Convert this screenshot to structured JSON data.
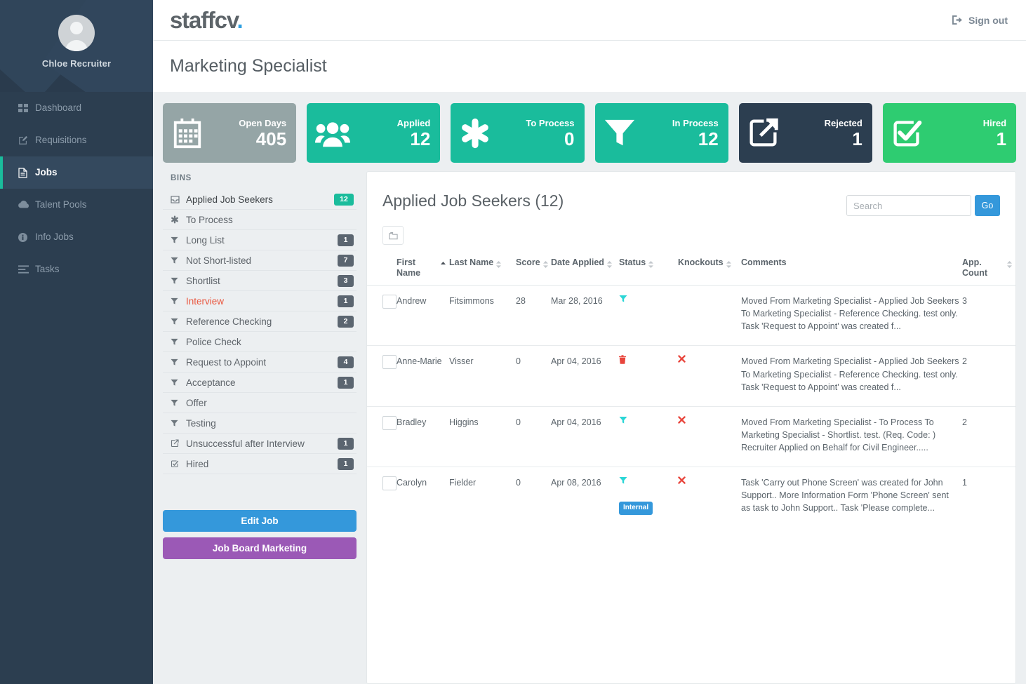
{
  "sidebar": {
    "user_name": "Chloe Recruiter",
    "items": [
      {
        "label": "Dashboard",
        "icon": "grid-icon",
        "active": false
      },
      {
        "label": "Requisitions",
        "icon": "edit-square-icon",
        "active": false
      },
      {
        "label": "Jobs",
        "icon": "document-icon",
        "active": true
      },
      {
        "label": "Talent Pools",
        "icon": "cloud-icon",
        "active": false
      },
      {
        "label": "Info Jobs",
        "icon": "info-circle-icon",
        "active": false
      },
      {
        "label": "Tasks",
        "icon": "list-icon",
        "active": false
      }
    ]
  },
  "topbar": {
    "logo": "staffcv",
    "logo_dot": ".",
    "signout_label": "Sign out"
  },
  "page": {
    "title": "Marketing Specialist"
  },
  "stats": [
    {
      "label": "Open Days",
      "value": "405",
      "icon": "calendar-icon",
      "color": "#95a5a6"
    },
    {
      "label": "Applied",
      "value": "12",
      "icon": "people-icon",
      "color": "#1abc9c"
    },
    {
      "label": "To Process",
      "value": "0",
      "icon": "asterisk-icon",
      "color": "#1abc9c"
    },
    {
      "label": "In Process",
      "value": "12",
      "icon": "funnel-icon",
      "color": "#1abc9c"
    },
    {
      "label": "Rejected",
      "value": "1",
      "icon": "external-link-icon",
      "color": "#2c3e50"
    },
    {
      "label": "Hired",
      "value": "1",
      "icon": "check-square-icon",
      "color": "#2ecc71"
    }
  ],
  "bins": {
    "heading": "BINS",
    "items": [
      {
        "label": "Applied Job Seekers",
        "count": "12",
        "icon": "inbox-icon",
        "style": "teal"
      },
      {
        "label": "To Process",
        "count": "",
        "icon": "asterisk-icon",
        "style": "normal"
      },
      {
        "label": "Long List",
        "count": "1",
        "icon": "funnel-icon",
        "style": "normal"
      },
      {
        "label": "Not Short-listed",
        "count": "7",
        "icon": "funnel-icon",
        "style": "normal"
      },
      {
        "label": "Shortlist",
        "count": "3",
        "icon": "funnel-icon",
        "style": "normal"
      },
      {
        "label": "Interview",
        "count": "1",
        "icon": "funnel-icon",
        "style": "alert"
      },
      {
        "label": "Reference Checking",
        "count": "2",
        "icon": "funnel-icon",
        "style": "normal"
      },
      {
        "label": "Police Check",
        "count": "",
        "icon": "funnel-icon",
        "style": "normal"
      },
      {
        "label": "Request to Appoint",
        "count": "4",
        "icon": "funnel-icon",
        "style": "normal"
      },
      {
        "label": "Acceptance",
        "count": "1",
        "icon": "funnel-icon",
        "style": "normal"
      },
      {
        "label": "Offer",
        "count": "",
        "icon": "funnel-icon",
        "style": "normal"
      },
      {
        "label": "Testing",
        "count": "",
        "icon": "funnel-icon",
        "style": "normal"
      },
      {
        "label": "Unsuccessful after Interview",
        "count": "1",
        "icon": "external-link-icon",
        "style": "normal"
      },
      {
        "label": "Hired",
        "count": "1",
        "icon": "check-square-icon",
        "style": "normal"
      }
    ],
    "edit_job_label": "Edit Job",
    "job_board_label": "Job Board Marketing"
  },
  "panel": {
    "title": "Applied Job Seekers (12)",
    "search_placeholder": "Search",
    "search_value": "",
    "go_label": "Go",
    "columns": [
      {
        "label": "First Name",
        "sort": "asc"
      },
      {
        "label": "Last Name",
        "sort": "both"
      },
      {
        "label": "Score",
        "sort": "both"
      },
      {
        "label": "Date Applied",
        "sort": "both"
      },
      {
        "label": "Status",
        "sort": "both"
      },
      {
        "label": "Knockouts",
        "sort": "both"
      },
      {
        "label": "Comments",
        "sort": "none"
      },
      {
        "label": "App. Count",
        "sort": "both"
      }
    ],
    "rows": [
      {
        "first_name": "Andrew",
        "last_name": "Fitsimmons",
        "score": "28",
        "date_applied": "Mar 28, 2016",
        "status_icon": "funnel-icon",
        "status_badge": "",
        "knockout_icon": "",
        "comments": "Moved From Marketing Specialist - Applied Job Seekers To Marketing Specialist - Reference Checking. test only. Task 'Request to Appoint' was created f...",
        "app_count": "3"
      },
      {
        "first_name": "Anne-Marie",
        "last_name": "Visser",
        "score": "0",
        "date_applied": "Apr 04, 2016",
        "status_icon": "trash-icon",
        "status_badge": "",
        "knockout_icon": "x-icon",
        "comments": "Moved From Marketing Specialist - Applied Job Seekers To Marketing Specialist - Reference Checking. test only. Task 'Request to Appoint' was created f...",
        "app_count": "2"
      },
      {
        "first_name": "Bradley",
        "last_name": "Higgins",
        "score": "0",
        "date_applied": "Apr 04, 2016",
        "status_icon": "funnel-icon",
        "status_badge": "",
        "knockout_icon": "x-icon",
        "comments": "Moved From Marketing Specialist - To Process To Marketing Specialist - Shortlist. test. (Req. Code: ) Recruiter Applied on Behalf for Civil Engineer.....",
        "app_count": "2"
      },
      {
        "first_name": "Carolyn",
        "last_name": "Fielder",
        "score": "0",
        "date_applied": "Apr 08, 2016",
        "status_icon": "funnel-icon",
        "status_badge": "Internal",
        "knockout_icon": "x-icon",
        "comments": "Task 'Carry out Phone Screen' was created for John Support.. More Information Form 'Phone Screen' sent as task to John Support.. Task 'Please complete...",
        "app_count": "1"
      }
    ]
  },
  "colors": {
    "sidebar_bg": "#2c3e50",
    "accent_teal": "#1abc9c",
    "accent_blue": "#3498db",
    "accent_purple": "#9b59b6",
    "accent_green": "#2ecc71",
    "grey_card": "#95a5a6",
    "dark_card": "#2c3e50",
    "status_cyan": "#2bd6d6",
    "danger_red": "#e8453c"
  }
}
